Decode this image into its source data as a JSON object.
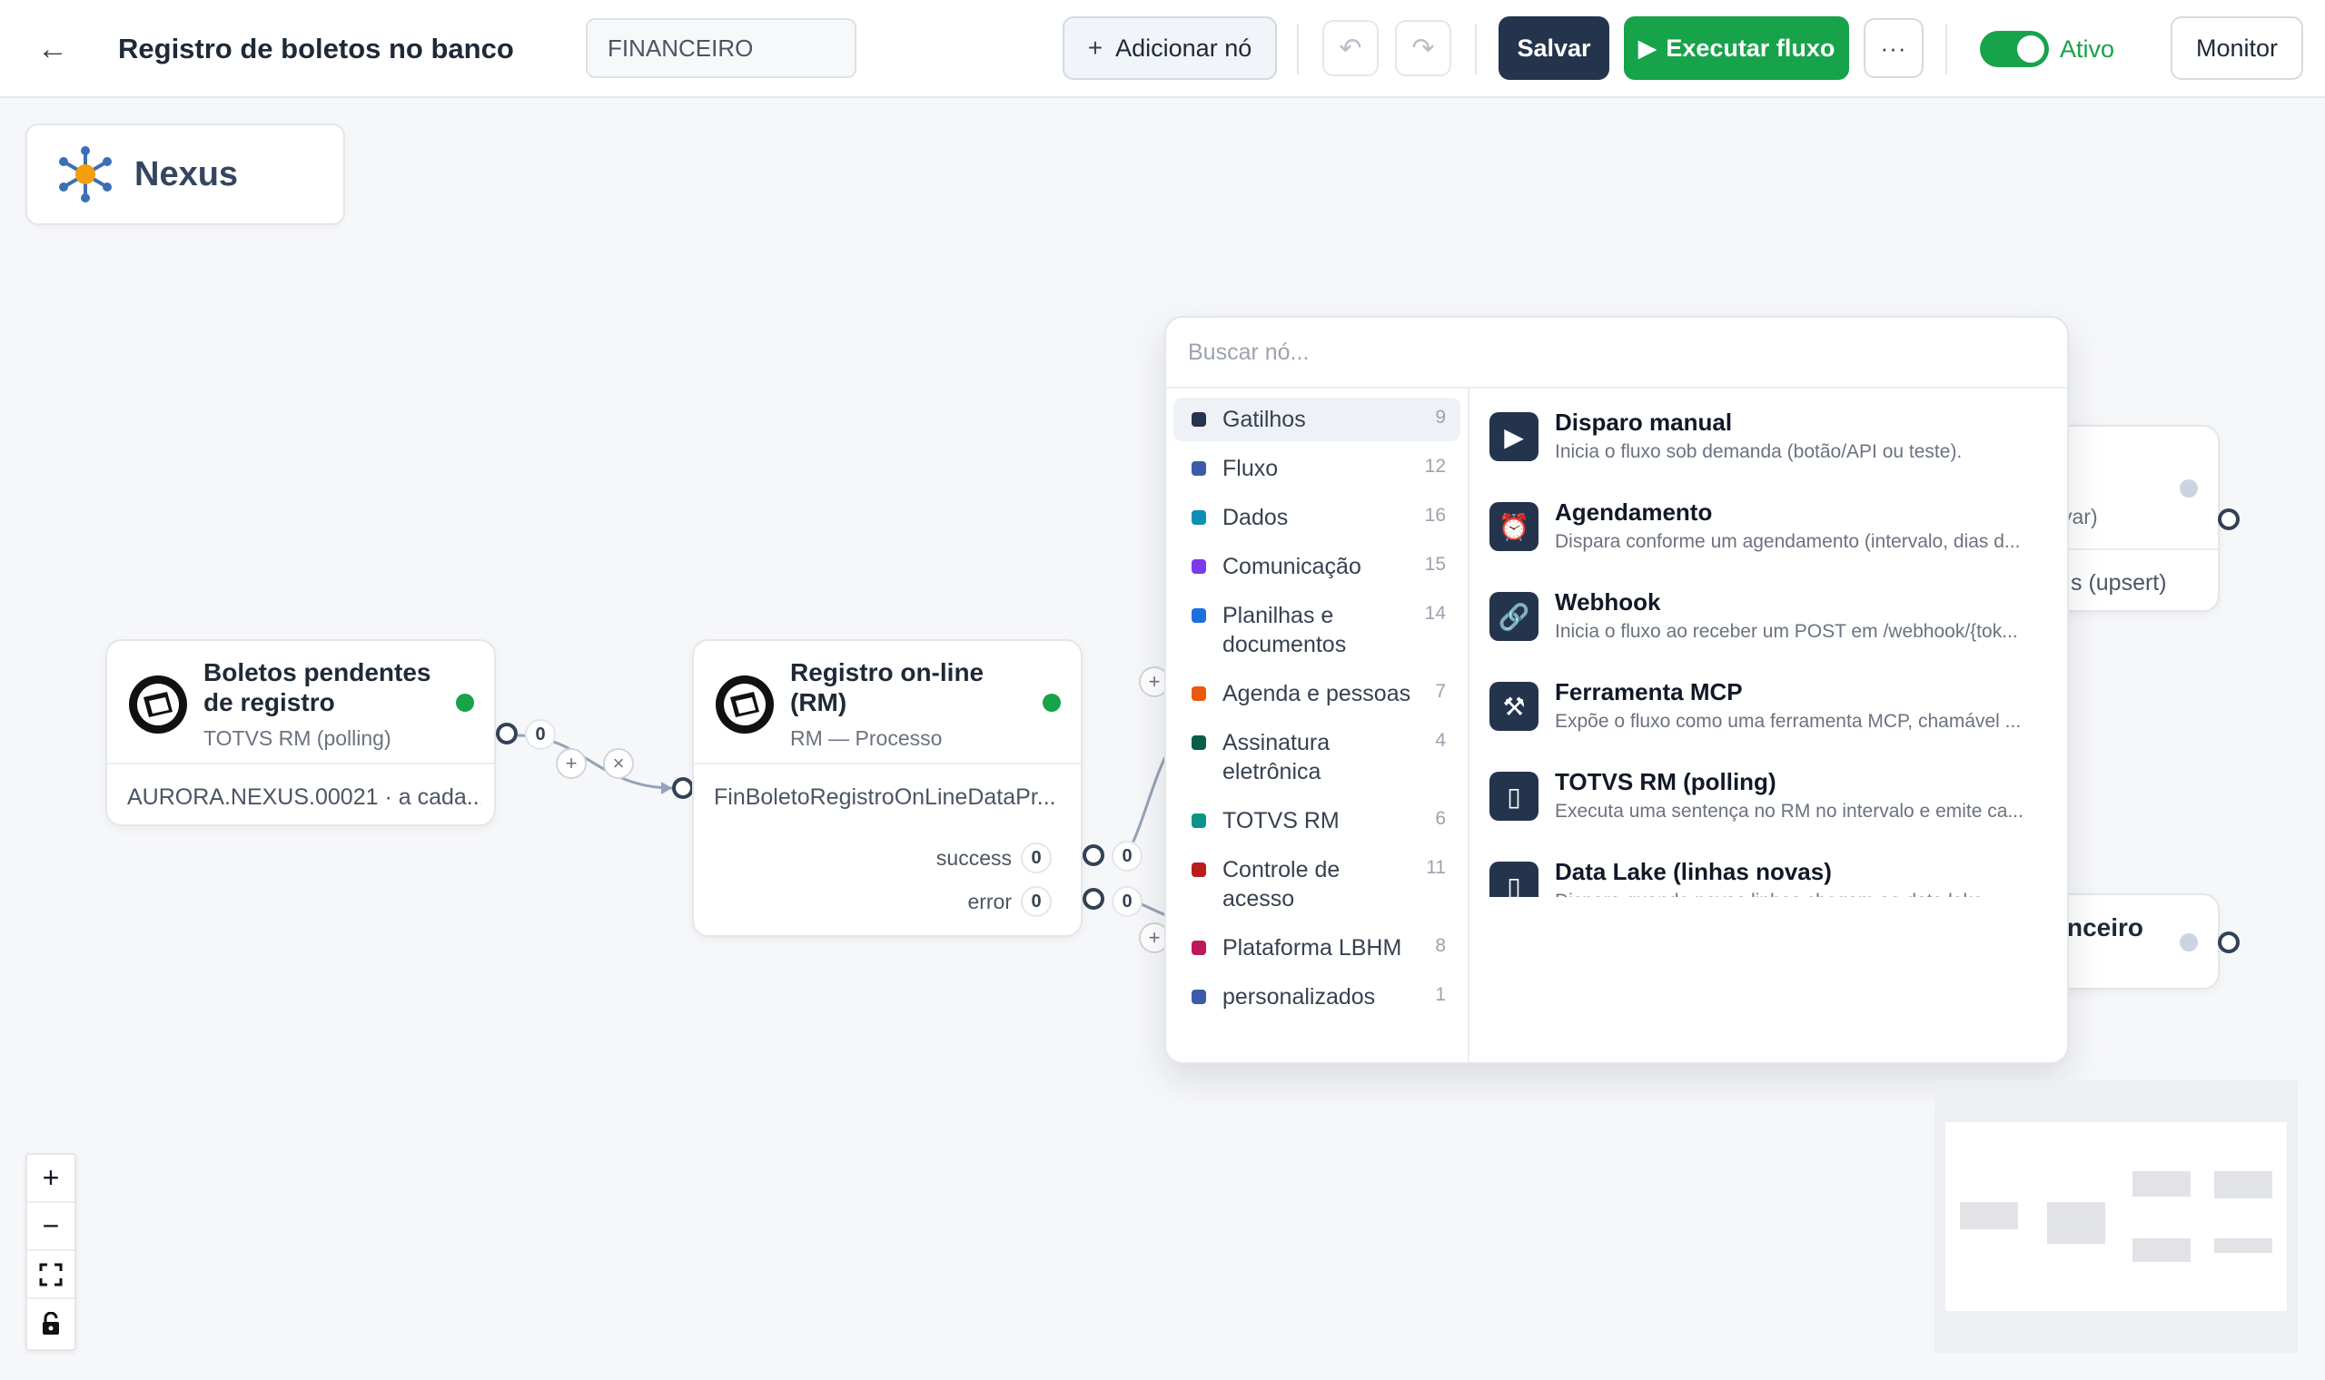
{
  "header": {
    "back_icon": "arrow-left",
    "title": "Registro de boletos no banco",
    "folder_value": "FINANCEIRO",
    "add_node_label": "Adicionar nó",
    "save_label": "Salvar",
    "run_label": "Executar fluxo",
    "more_label": "···",
    "active_label": "Ativo",
    "active": true,
    "monitor_label": "Monitor"
  },
  "brand": {
    "name": "Nexus"
  },
  "nodes": [
    {
      "title_line1": "Boletos pendentes",
      "title_line2": "de registro",
      "subtitle": "TOTVS RM (polling)",
      "body": "AURORA.NEXUS.00021 · a cada...",
      "output_count": "0",
      "status": "active"
    },
    {
      "title_line1": "Registro on-line",
      "title_line2": "(RM)",
      "subtitle": "RM — Processo",
      "body": "FinBoletoRegistroOnLineDataPr...",
      "outputs": [
        {
          "label": "success",
          "count": "0",
          "edge_count": "0"
        },
        {
          "label": "error",
          "count": "0",
          "edge_count": "0"
        }
      ],
      "status": "active"
    },
    {
      "partial_text_1": "var)",
      "partial_text_2": "s (upsert)"
    },
    {
      "partial_text": "nceiro"
    }
  ],
  "edge_actions": {
    "add": "+",
    "remove": "×"
  },
  "picker": {
    "search_placeholder": "Buscar nó...",
    "categories": [
      {
        "label": "Gatilhos",
        "count": "9",
        "color": "#25344d"
      },
      {
        "label": "Fluxo",
        "count": "12",
        "color": "#3b5ba8"
      },
      {
        "label": "Dados",
        "count": "16",
        "color": "#0891b2"
      },
      {
        "label": "Comunicação",
        "count": "15",
        "color": "#7c3aed"
      },
      {
        "label": "Planilhas e documentos",
        "count": "14",
        "color": "#1d6fe0"
      },
      {
        "label": "Agenda e pessoas",
        "count": "7",
        "color": "#ea580c"
      },
      {
        "label": "Assinatura eletrônica",
        "count": "4",
        "color": "#065f46"
      },
      {
        "label": "TOTVS RM",
        "count": "6",
        "color": "#0d9488"
      },
      {
        "label": "Controle de acesso",
        "count": "11",
        "color": "#b91c1c"
      },
      {
        "label": "Plataforma LBHM",
        "count": "8",
        "color": "#be185d"
      },
      {
        "label": "personalizados",
        "count": "1",
        "color": "#3b5ba8"
      }
    ],
    "items": [
      {
        "icon": "play-icon",
        "title": "Disparo manual",
        "desc": "Inicia o fluxo sob demanda (botão/API ou teste)."
      },
      {
        "icon": "alarm-clock-icon",
        "title": "Agendamento",
        "desc": "Dispara conforme um agendamento (intervalo, dias d..."
      },
      {
        "icon": "link-icon",
        "title": "Webhook",
        "desc": "Inicia o fluxo ao receber um POST em /webhook/{tok..."
      },
      {
        "icon": "tools-icon",
        "title": "Ferramenta MCP",
        "desc": "Expõe o fluxo como uma ferramenta MCP, chamável ..."
      },
      {
        "icon": "database-icon",
        "title": "TOTVS RM (polling)",
        "desc": "Executa uma sentença no RM no intervalo e emite ca..."
      },
      {
        "icon": "database-icon",
        "title": "Data Lake (linhas novas)",
        "desc": "Dispara quando novas linhas chegam ao data lake..."
      }
    ]
  },
  "controls": {
    "zoom_in": "+",
    "zoom_out": "−",
    "fit": "fit-view-icon",
    "lock": "lock-icon"
  }
}
